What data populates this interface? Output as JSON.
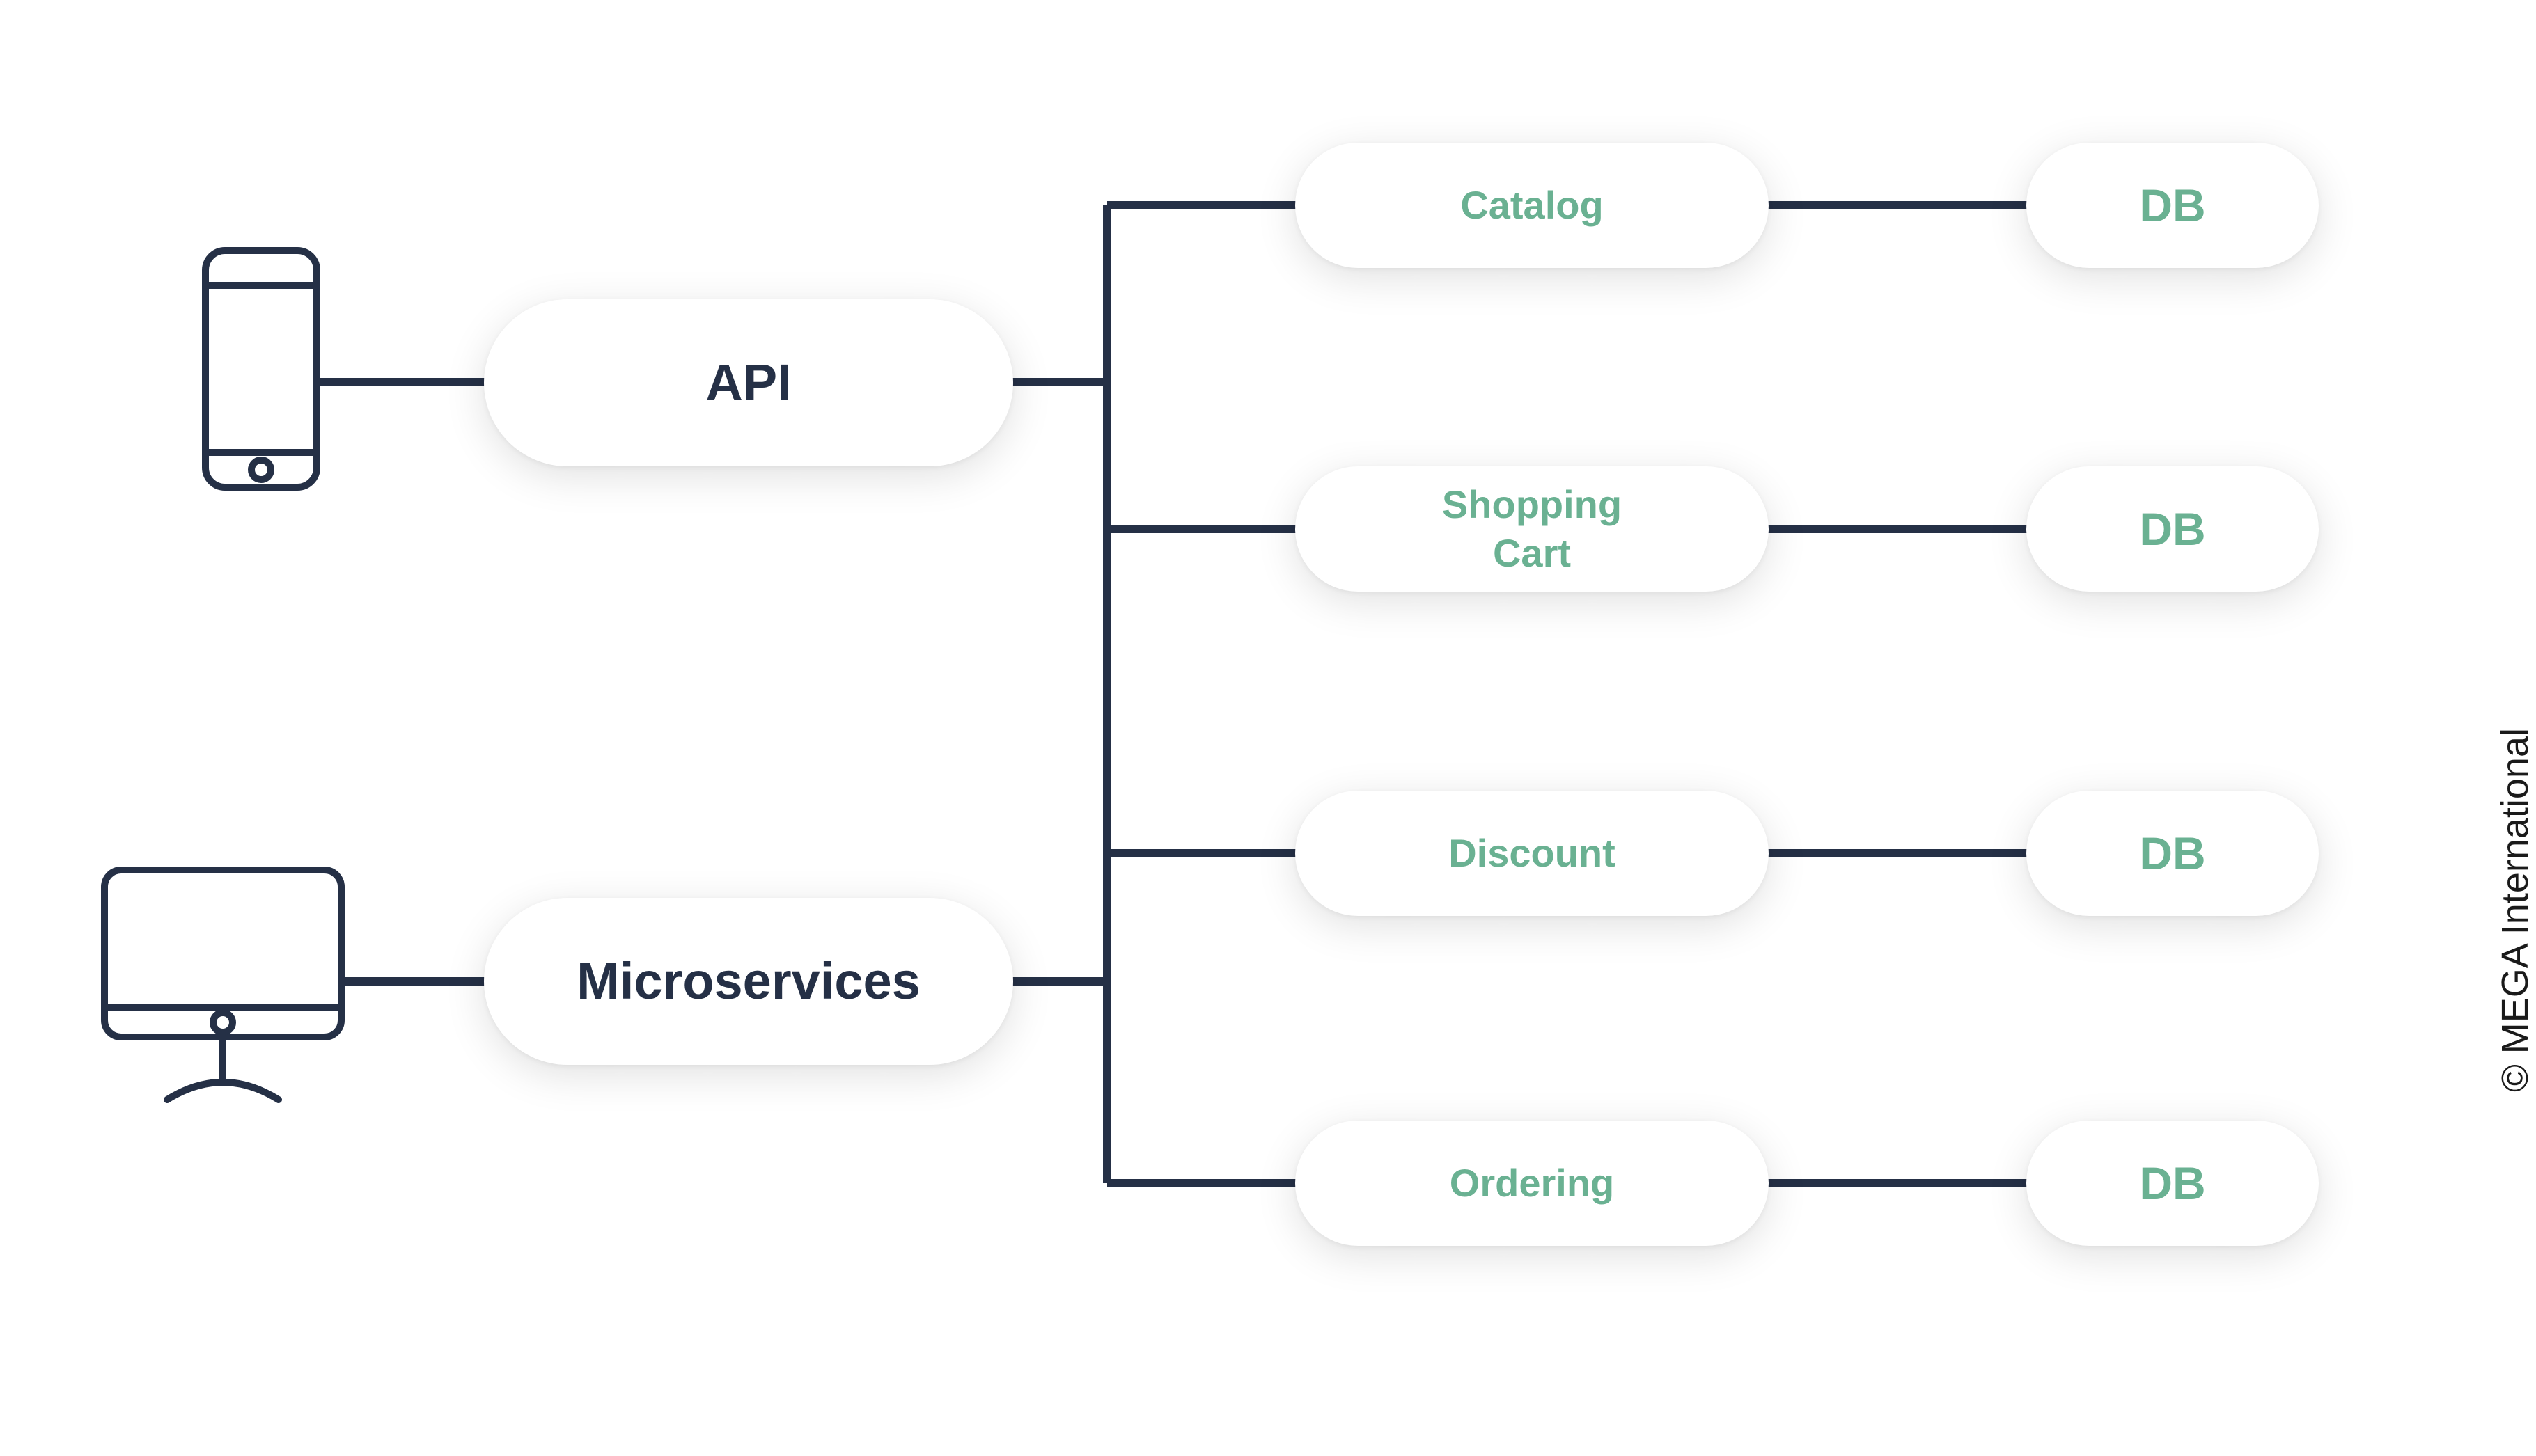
{
  "colors": {
    "line": "#253046",
    "api_text": "#253046",
    "service_text": "#6ab192",
    "db_text": "#6ab192",
    "pill_bg": "#ffffff"
  },
  "nodes": {
    "api": {
      "label": "API"
    },
    "microservices": {
      "label": "Microservices"
    }
  },
  "services": [
    {
      "label": "Catalog",
      "db_label": "DB"
    },
    {
      "label": "Shopping\nCart",
      "db_label": "DB"
    },
    {
      "label": "Discount",
      "db_label": "DB"
    },
    {
      "label": "Ordering",
      "db_label": "DB"
    }
  ],
  "watermark": "© MEGA International"
}
